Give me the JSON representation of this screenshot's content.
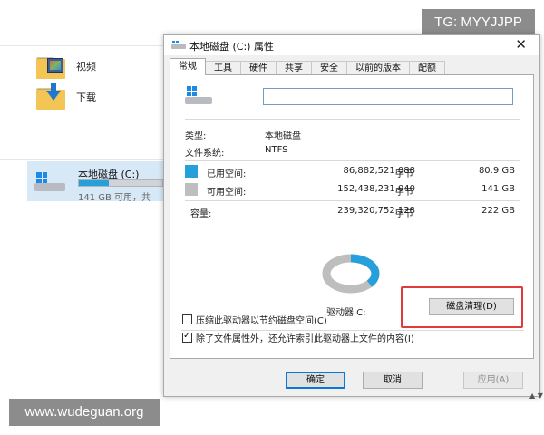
{
  "watermarks": {
    "top_right": "TG: MYYJJPP",
    "bottom_left": "www.wudeguan.org"
  },
  "explorer": {
    "folders": [
      {
        "label": "视频",
        "icon": "video-folder-icon"
      },
      {
        "label": "下载",
        "icon": "download-folder-icon"
      }
    ],
    "drive": {
      "name": "本地磁盘 (C:)",
      "free_text": "141 GB 可用，共",
      "used_fraction": 0.36
    }
  },
  "dialog": {
    "title": "本地磁盘 (C:) 属性",
    "close_glyph": "✕",
    "tabs": [
      {
        "label": "常规",
        "active": true
      },
      {
        "label": "工具",
        "active": false
      },
      {
        "label": "硬件",
        "active": false
      },
      {
        "label": "共享",
        "active": false
      },
      {
        "label": "安全",
        "active": false
      },
      {
        "label": "以前的版本",
        "active": false
      },
      {
        "label": "配额",
        "active": false
      }
    ],
    "general": {
      "name_value": "",
      "type_label": "类型:",
      "type_value": "本地磁盘",
      "fs_label": "文件系统:",
      "fs_value": "NTFS",
      "used_label": "已用空间:",
      "used_bytes": "86,882,521,088",
      "used_gb": "80.9 GB",
      "free_label": "可用空间:",
      "free_bytes": "152,438,231,040",
      "free_gb": "141 GB",
      "capacity_label": "容量:",
      "capacity_bytes": "239,320,752,128",
      "capacity_gb": "222 GB",
      "unit_bytes": "字节",
      "drive_caption": "驱动器 C:",
      "cleanup_button": "磁盘清理(D)",
      "used_fraction": 0.363,
      "compress_label": "压缩此驱动器以节约磁盘空间(C)",
      "compress_checked": false,
      "index_label": "除了文件属性外，还允许索引此驱动器上文件的内容(I)",
      "index_checked": true
    },
    "buttons": {
      "ok": "确定",
      "cancel": "取消",
      "apply": "应用(A)"
    },
    "edge_text": "▲ ▼"
  },
  "colors": {
    "used": "#26a0da",
    "free": "#bebebe",
    "highlight": "#e03a3a",
    "focus_border": "#0a78d7"
  }
}
